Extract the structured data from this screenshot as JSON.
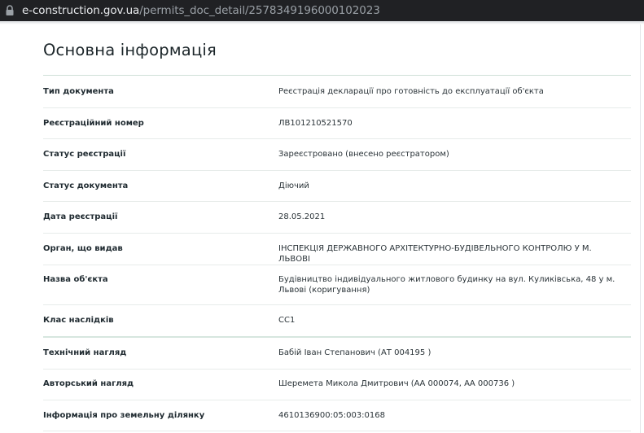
{
  "browser": {
    "url_domain": "e-construction.gov.ua",
    "url_path": "/permits_doc_detail/2578349196000102023"
  },
  "section": {
    "title": "Основна інформація"
  },
  "rows": [
    {
      "label": "Тип документа",
      "value": "Реєстрація декларації про готовність до експлуатації об'єкта"
    },
    {
      "label": "Реєстраційний номер",
      "value": "ЛВ101210521570"
    },
    {
      "label": "Статус реєстрації",
      "value": "Зареєстровано (внесено реєстратором)"
    },
    {
      "label": "Статус документа",
      "value": "Діючий"
    },
    {
      "label": "Дата реєстрації",
      "value": "28.05.2021"
    },
    {
      "label": "Орган, що видав",
      "value": "ІНСПЕКЦІЯ ДЕРЖАВНОГО АРХІТЕКТУРНО-БУДІВЕЛЬНОГО КОНТРОЛЮ У М. ЛЬВОВІ"
    },
    {
      "label": "Назва об'єкта",
      "value": "Будівництво індивідуального житлового будинку на вул. Куликівська, 48 у м. Львові (коригування)"
    },
    {
      "label": "Клас наслідків",
      "value": "СС1"
    },
    {
      "label": "Технічний нагляд",
      "value": "Бабій Іван Степанович (АТ 004195 )"
    },
    {
      "label": "Авторський нагляд",
      "value": "Шеремета Микола Дмитрович (АА 000074, АА 000736 )"
    },
    {
      "label": "Інформація про земельну ділянку",
      "value": "4610136900:05:003:0168"
    }
  ]
}
